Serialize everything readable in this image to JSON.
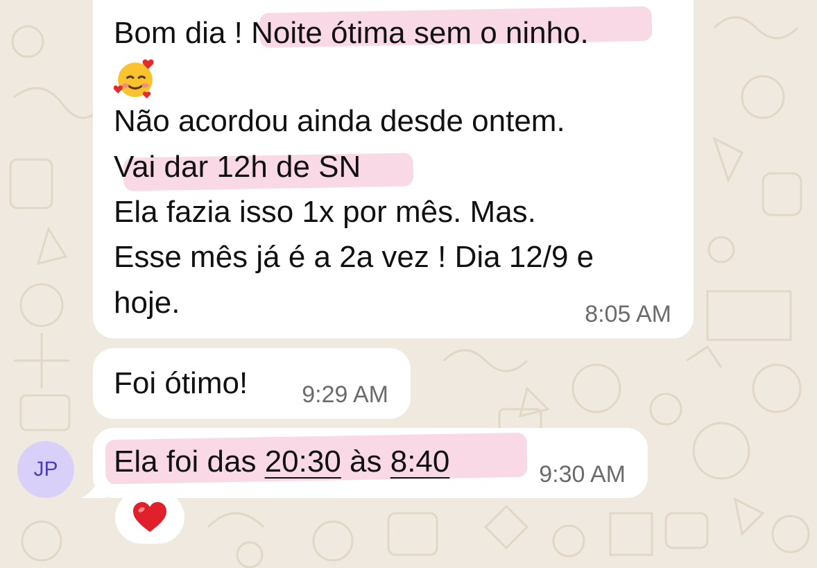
{
  "messages": [
    {
      "lines": [
        "Bom dia ! Noite ótima sem o ninho.",
        "🥰",
        "Não acordou ainda desde ontem.",
        "Vai dar 12h de SN",
        "Ela fazia isso 1x por mês. Mas.",
        "Esse mês já é a 2a vez ! Dia 12/9 e",
        "hoje."
      ],
      "time": "8:05 AM"
    },
    {
      "text": "Foi ótimo!",
      "time": "9:29 AM"
    },
    {
      "text_prefix": "Ela foi das ",
      "time_start": "20:30",
      "text_middle": " às ",
      "time_end": "8:40",
      "time": "9:30 AM",
      "reaction": "❤️"
    }
  ],
  "sender": {
    "initials": "JP"
  },
  "colors": {
    "background": "#efe9df",
    "bubble": "#ffffff",
    "highlight": "#ec78aa",
    "avatar_bg": "#d9d0fa",
    "avatar_text": "#4b3fb5",
    "reaction": "#e0202a"
  },
  "icons": [
    "smiling-face-with-hearts-emoji",
    "red-heart-icon"
  ]
}
